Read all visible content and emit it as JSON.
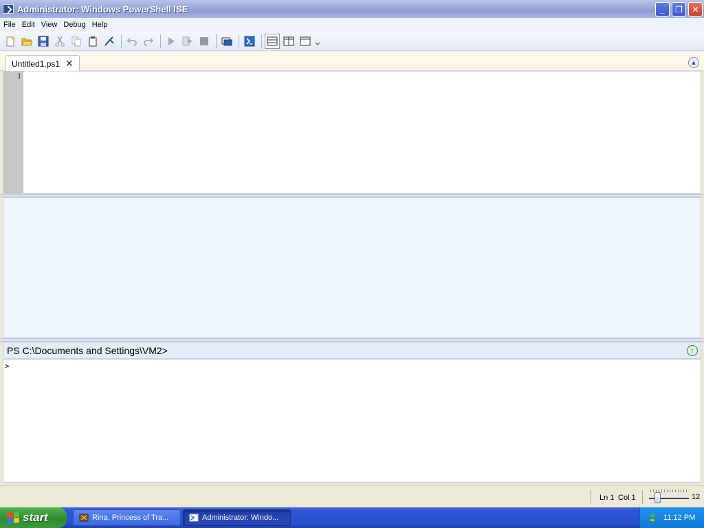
{
  "window": {
    "title": "Administrator: Windows PowerShell ISE"
  },
  "menu": [
    {
      "label": "File"
    },
    {
      "label": "Edit"
    },
    {
      "label": "View"
    },
    {
      "label": "Debug"
    },
    {
      "label": "Help"
    }
  ],
  "toolbar": {
    "icons": [
      "new-file-icon",
      "open-file-icon",
      "save-icon",
      "cut-icon",
      "copy-icon",
      "paste-icon",
      "clear-icon",
      "undo-icon",
      "redo-icon",
      "run-icon",
      "run-selection-icon",
      "stop-icon",
      "new-remote-tab-icon",
      "powershell-icon",
      "layout-top-icon",
      "layout-right-icon",
      "layout-max-icon"
    ]
  },
  "tabs": [
    {
      "label": "Untitled1.ps1",
      "close": "✕"
    }
  ],
  "editor": {
    "line_numbers": [
      "1"
    ]
  },
  "command_pane": {
    "prompt_path": "PS C:\\Documents and Settings\\VM2>",
    "input_prompt": ">"
  },
  "status": {
    "line": "Ln 1",
    "col": "Col 1",
    "zoom": "12"
  },
  "taskbar": {
    "start_label": "start",
    "tasks": [
      {
        "label": "Rina, Princess of Tra..."
      },
      {
        "label": "Administrator: Windo..."
      }
    ],
    "clock": "11:12 PM"
  }
}
